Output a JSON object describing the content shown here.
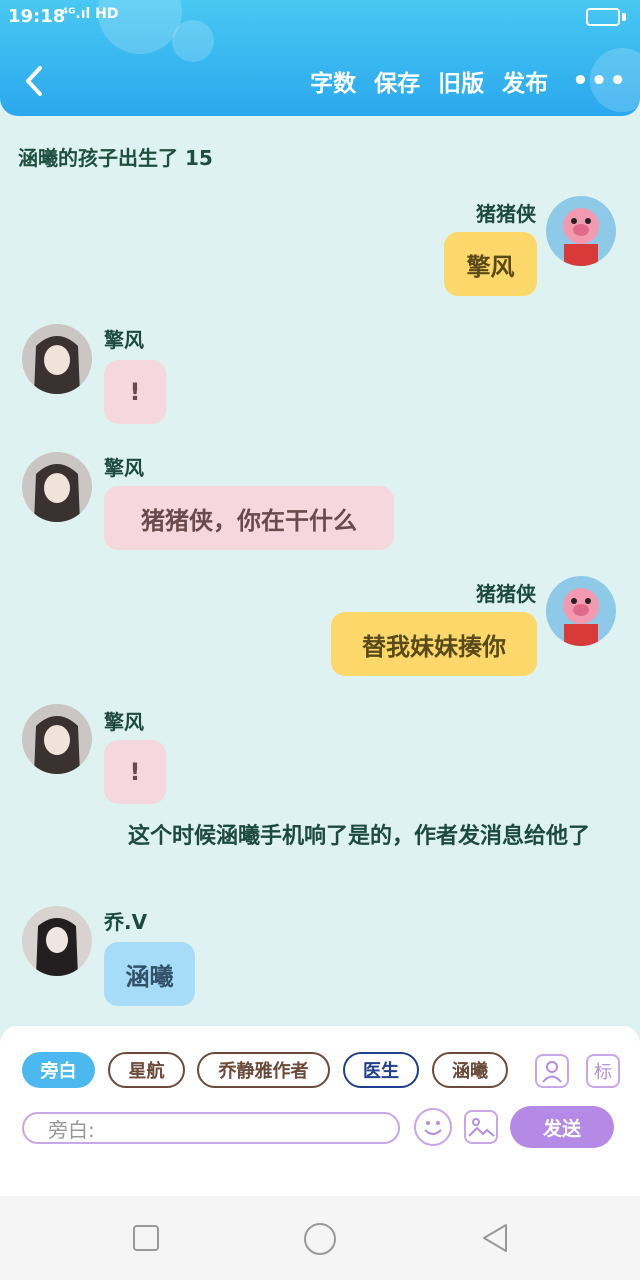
{
  "status_bar": {
    "time": "19:18",
    "network": "⁴ᴳ.ıl HD"
  },
  "header": {
    "back_icon": "chevron-left-icon",
    "actions": [
      "字数",
      "保存",
      "旧版",
      "发布"
    ],
    "more": "•••"
  },
  "chapter": {
    "title": "涵曦的孩子出生了 15"
  },
  "messages": [
    {
      "side": "right",
      "sender": "猪猪侠",
      "text": "擎风",
      "color": "yellow"
    },
    {
      "side": "left",
      "sender": "擎风",
      "text": "!",
      "color": "pink"
    },
    {
      "side": "left",
      "sender": "擎风",
      "text": "猪猪侠，你在干什么",
      "color": "pink"
    },
    {
      "side": "right",
      "sender": "猪猪侠",
      "text": "替我妹妹揍你",
      "color": "yellow"
    },
    {
      "side": "left",
      "sender": "擎风",
      "text": "!",
      "color": "pink"
    },
    {
      "side": "left",
      "sender": "乔.V",
      "text": "涵曦",
      "color": "blue"
    }
  ],
  "narration": "这个时候涵曦手机响了是的，作者发消息给他了",
  "composer": {
    "chips": [
      "旁白",
      "星航",
      "乔静雅作者",
      "医生",
      "涵曦"
    ],
    "placeholder": "旁白:",
    "send": "发送",
    "tag_icon_label": "标"
  },
  "colors": {
    "header": "#2aa8ee",
    "background": "#dff2f2",
    "send": "#b48ae6",
    "active_chip": "#4bb9f0"
  }
}
